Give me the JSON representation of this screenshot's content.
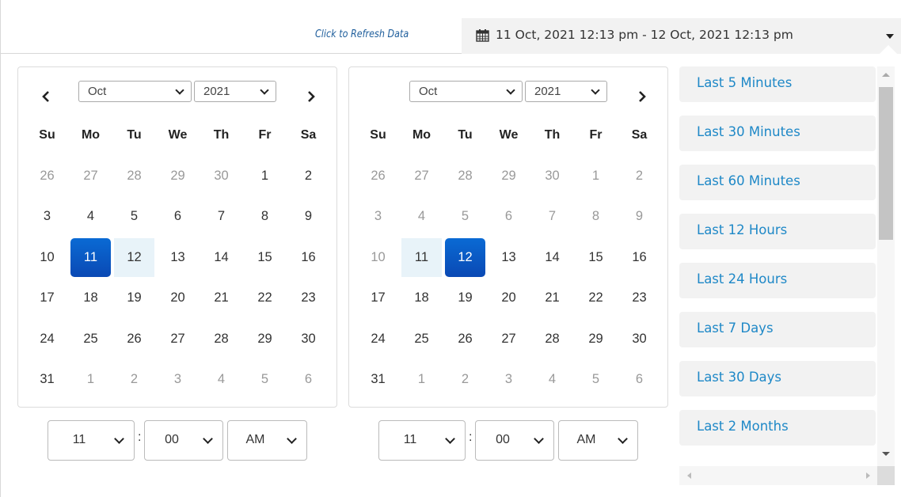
{
  "header": {
    "refresh_label": "Click to Refresh Data",
    "range_text": "11 Oct, 2021 12:13 pm - 12 Oct, 2021 12:13 pm"
  },
  "weekdays": [
    "Su",
    "Mo",
    "Tu",
    "We",
    "Th",
    "Fr",
    "Sa"
  ],
  "left_calendar": {
    "month": "Oct",
    "year": "2021",
    "days": [
      "26",
      "27",
      "28",
      "29",
      "30",
      "1",
      "2",
      "3",
      "4",
      "5",
      "6",
      "7",
      "8",
      "9",
      "10",
      "11",
      "12",
      "13",
      "14",
      "15",
      "16",
      "17",
      "18",
      "19",
      "20",
      "21",
      "22",
      "23",
      "24",
      "25",
      "26",
      "27",
      "28",
      "29",
      "30",
      "31",
      "1",
      "2",
      "3",
      "4",
      "5",
      "6"
    ],
    "selected_day": "11",
    "time": {
      "hour": "11",
      "minute": "00",
      "ampm": "AM"
    }
  },
  "right_calendar": {
    "month": "Oct",
    "year": "2021",
    "days": [
      "26",
      "27",
      "28",
      "29",
      "30",
      "1",
      "2",
      "3",
      "4",
      "5",
      "6",
      "7",
      "8",
      "9",
      "10",
      "11",
      "12",
      "13",
      "14",
      "15",
      "16",
      "17",
      "18",
      "19",
      "20",
      "21",
      "22",
      "23",
      "24",
      "25",
      "26",
      "27",
      "28",
      "29",
      "30",
      "31",
      "1",
      "2",
      "3",
      "4",
      "5",
      "6"
    ],
    "selected_day": "12",
    "time": {
      "hour": "11",
      "minute": "00",
      "ampm": "AM"
    }
  },
  "ranges": [
    "Last 5 Minutes",
    "Last 30 Minutes",
    "Last 60 Minutes",
    "Last 12 Hours",
    "Last 24 Hours",
    "Last 7 Days",
    "Last 30 Days",
    "Last 2 Months"
  ],
  "colors": {
    "accent": "#1e88c7",
    "selected": "#0a5fc4",
    "in_range": "#e8f3f9",
    "range_bg": "#f2f2f2"
  }
}
